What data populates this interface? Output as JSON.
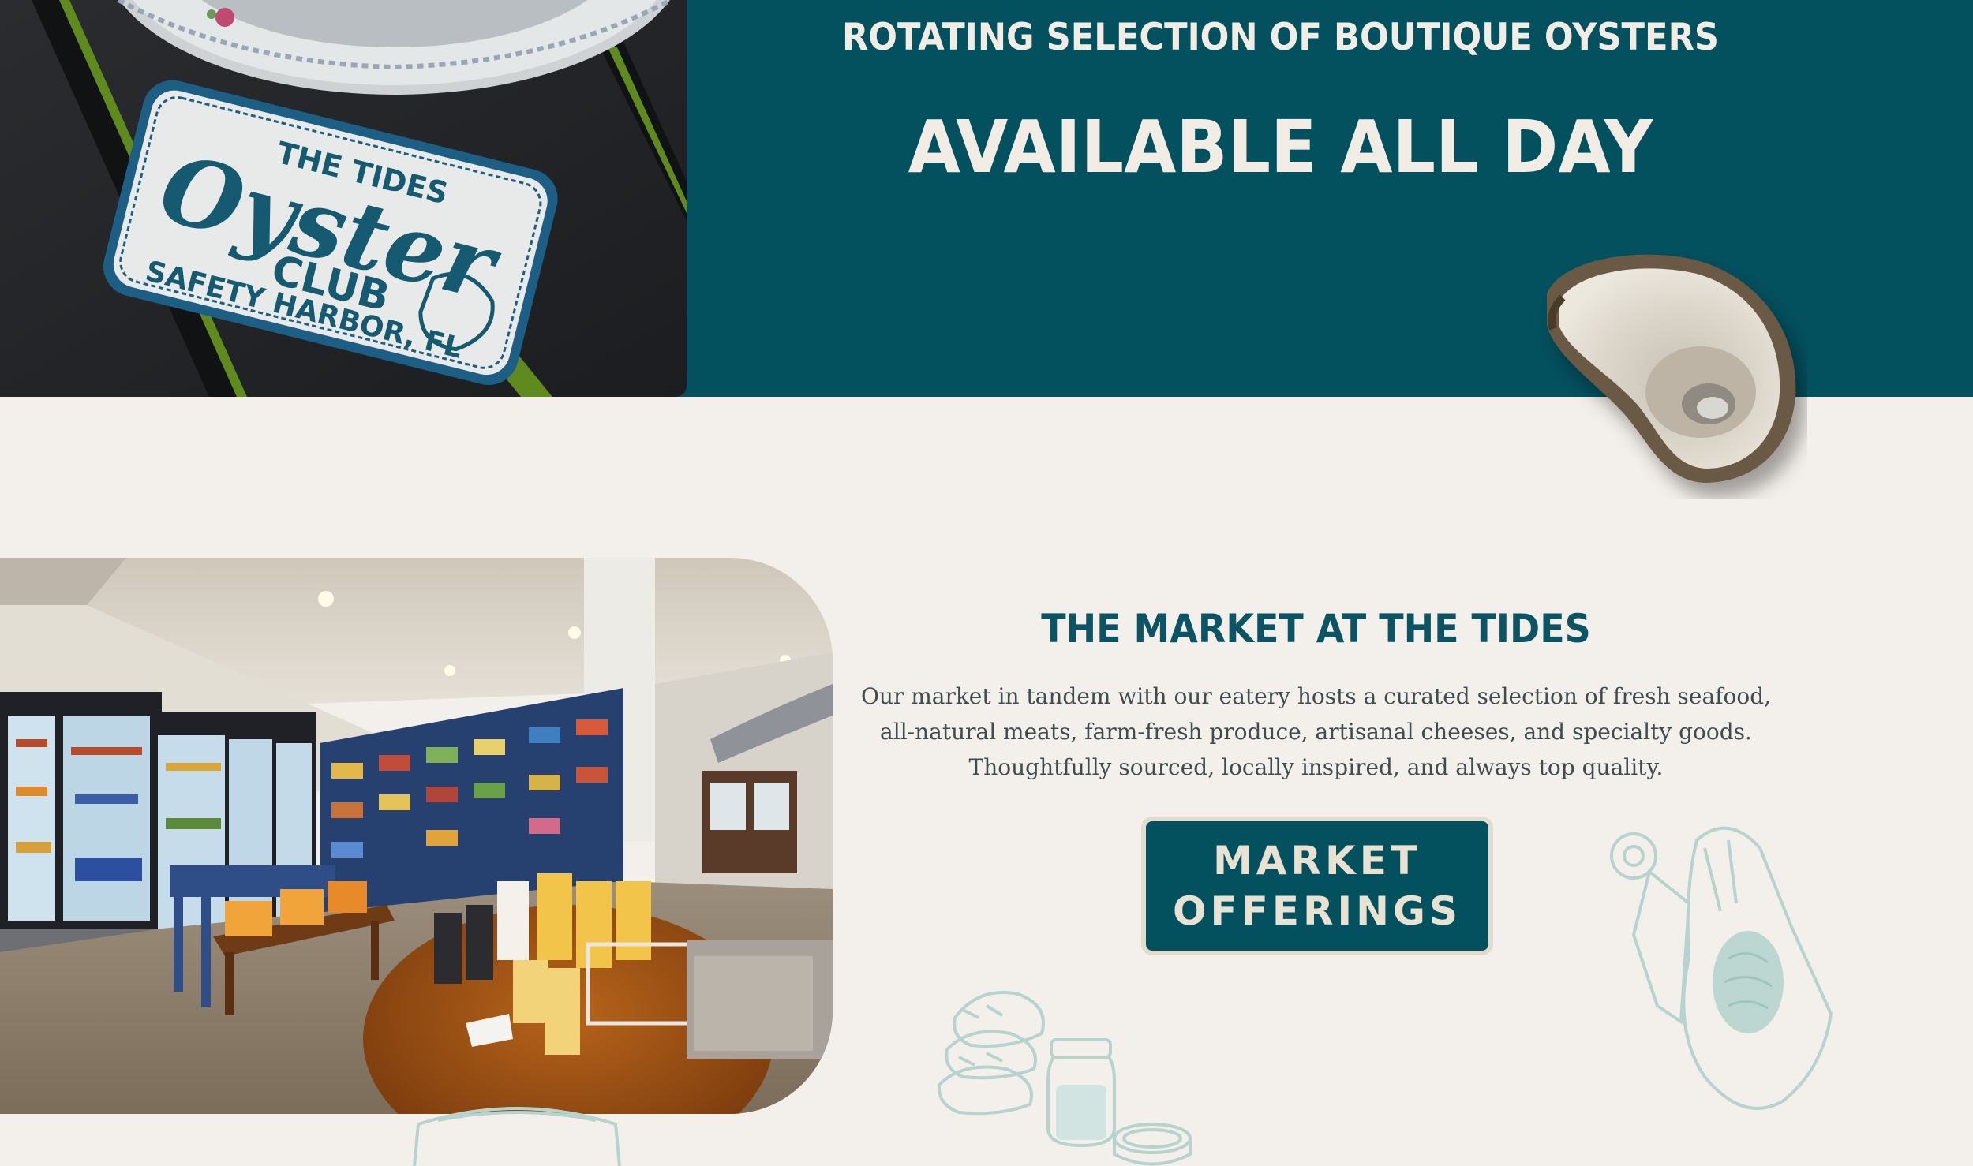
{
  "banner": {
    "subtitle": "ROTATING SELECTION OF BOUTIQUE OYSTERS",
    "title": "AVAILABLE ALL DAY",
    "background_color": "#03505f",
    "patch_text": [
      "THE TIDES",
      "Oyster",
      "CLUB",
      "SAFETY HARBOR, FL"
    ]
  },
  "market": {
    "title": "THE MARKET AT THE TIDES",
    "description": "Our market in tandem with our eatery hosts a curated selection of fresh seafood, all-natural meats, farm-fresh produce, artisanal cheeses, and specialty goods. Thoughtfully sourced, locally inspired, and always top quality.",
    "button_line1": "MARKET",
    "button_line2": "OFFERINGS",
    "accent_color": "#0c5463"
  },
  "icons": [
    "oyster-shell-icon",
    "bread-sketch-icon",
    "jar-sketch-icon",
    "cutting-board-sketch-icon",
    "bowl-sketch-icon"
  ]
}
